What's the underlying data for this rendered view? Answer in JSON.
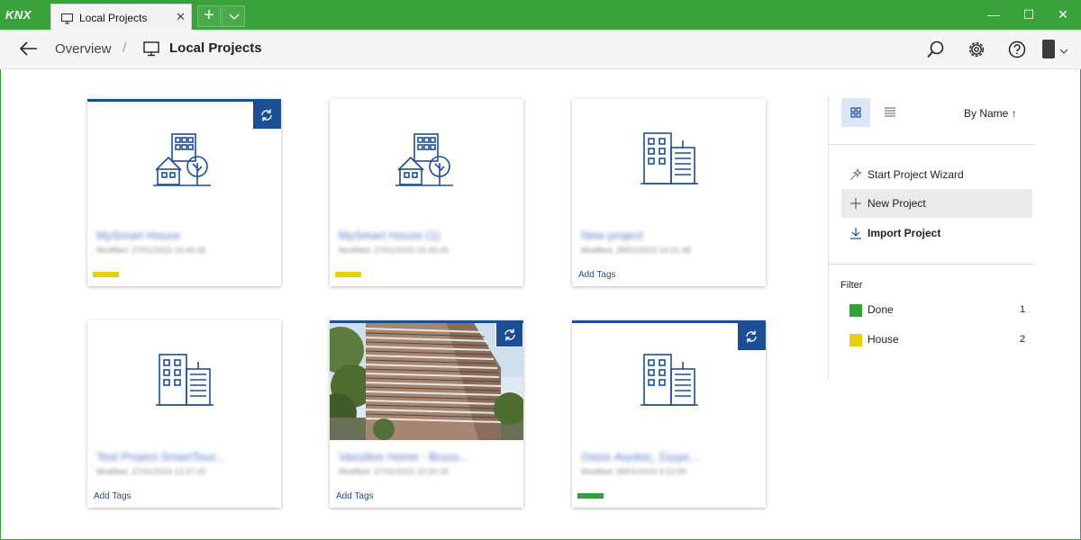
{
  "app": {
    "logo": "KNX",
    "tab_label": "Local Projects",
    "tab_close": "✕",
    "new_tab": "+",
    "window": {
      "minimize": "—",
      "maximize": "☐",
      "close": "✕"
    }
  },
  "header": {
    "breadcrumb_overview": "Overview",
    "breadcrumb_separator": "/",
    "breadcrumb_current": "Local Projects"
  },
  "projects": [
    {
      "title": "MySmart House",
      "meta": "Modified: 27/01/2023 16:43:35",
      "icon": "house-tree-building-icon",
      "synced": true,
      "tag_color": "#e8cf0c",
      "add_tags": ""
    },
    {
      "title": "MySmart House (1)",
      "meta": "Modified: 27/01/2023 16:43:25",
      "icon": "house-tree-building-icon",
      "synced": false,
      "tag_color": "#e8cf0c",
      "add_tags": ""
    },
    {
      "title": "New project",
      "meta": "Modified: 28/01/2023 10:21:48",
      "icon": "office-building-icon",
      "synced": false,
      "tag_color": "",
      "add_tags": "Add Tags"
    },
    {
      "title": "Test Project SmartTouc...",
      "meta": "Modified: 27/01/2023 12:27:22",
      "icon": "office-building-icon",
      "synced": false,
      "tag_color": "",
      "add_tags": "Add Tags"
    },
    {
      "title": "Vassilios Home - Bruss...",
      "meta": "Modified: 27/01/2023 10:20:18",
      "icon": "building-photo",
      "synced": true,
      "tag_color": "",
      "add_tags": "Add Tags"
    },
    {
      "title": "Oasis Αιγαίας, Σερρε...",
      "meta": "Modified: 28/01/2023 9:12:50",
      "icon": "office-building-icon",
      "synced": true,
      "tag_color": "#2ea33a",
      "add_tags": ""
    }
  ],
  "panel": {
    "sort_label": "By Name ↑",
    "actions": [
      {
        "label": "Start Project Wizard",
        "icon": "wizard-wand-icon"
      },
      {
        "label": "New Project",
        "icon": "plus-icon"
      },
      {
        "label": "Import Project",
        "icon": "import-arrow-icon"
      }
    ],
    "filter_title": "Filter",
    "filters": [
      {
        "label": "Done",
        "count": "1",
        "color": "#2ea33a"
      },
      {
        "label": "House",
        "count": "2",
        "color": "#e8cf0c"
      }
    ]
  },
  "colors": {
    "titlebar": "#3aa23a",
    "accent_blue": "#1c4e96",
    "tag_yellow": "#e8cf0c",
    "tag_green": "#2ea33a"
  }
}
